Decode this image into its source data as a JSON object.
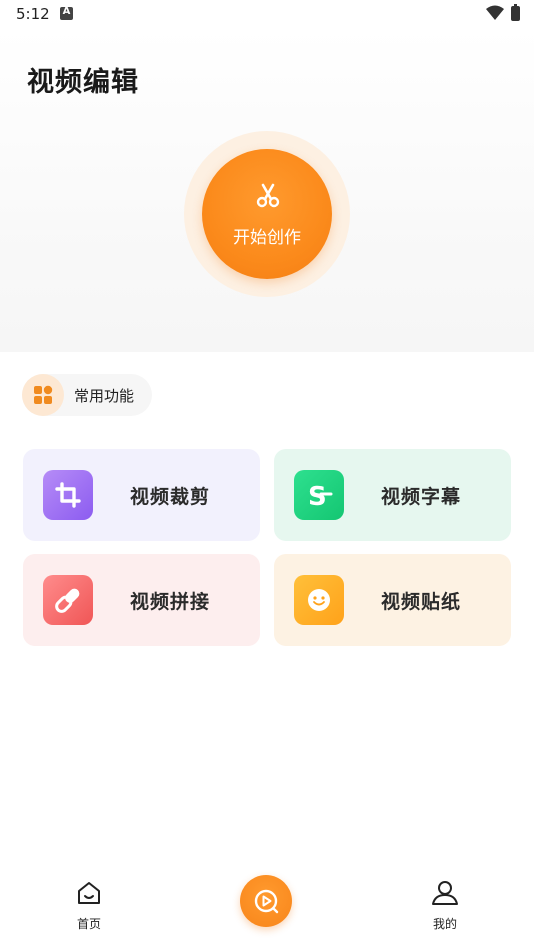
{
  "status_bar": {
    "time": "5:12"
  },
  "header": {
    "title": "视频编辑"
  },
  "hero": {
    "create_label": "开始创作"
  },
  "section": {
    "label": "常用功能"
  },
  "cards": [
    {
      "label": "视频裁剪",
      "icon": "crop-icon",
      "bg": "#f2f1fd",
      "accent": "#9a6cf3"
    },
    {
      "label": "视频字幕",
      "icon": "subtitle-s-icon",
      "bg": "#e6f7ef",
      "accent": "#1bcf7c"
    },
    {
      "label": "视频拼接",
      "icon": "link-icon",
      "bg": "#fdeeee",
      "accent": "#f56a6a"
    },
    {
      "label": "视频贴纸",
      "icon": "smiley-icon",
      "bg": "#fdf2e3",
      "accent": "#ffb02a"
    }
  ],
  "bottom_nav": {
    "items": [
      {
        "label": "首页",
        "icon": "home-icon"
      },
      {
        "label": "",
        "icon": "video-play-icon"
      },
      {
        "label": "我的",
        "icon": "profile-icon"
      }
    ]
  },
  "colors": {
    "brand_orange": "#fb8a1b"
  }
}
